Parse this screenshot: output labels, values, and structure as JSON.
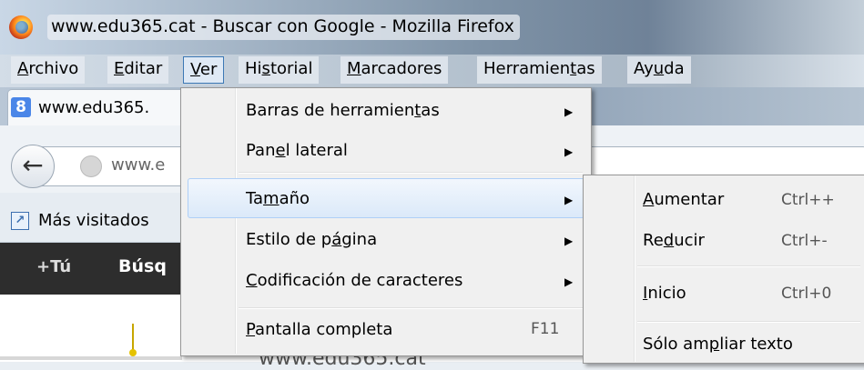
{
  "window": {
    "title": "www.edu365.cat - Buscar con Google - Mozilla Firefox"
  },
  "menubar": {
    "archivo": {
      "pre": "",
      "u": "A",
      "post": "rchivo"
    },
    "editar": {
      "pre": "",
      "u": "E",
      "post": "ditar"
    },
    "ver": {
      "pre": "",
      "u": "V",
      "post": "er"
    },
    "historial": {
      "pre": "Hi",
      "u": "s",
      "post": "torial"
    },
    "marcadores": {
      "pre": "",
      "u": "M",
      "post": "arcadores"
    },
    "herramientas": {
      "pre": "Herramien",
      "u": "t",
      "post": "as"
    },
    "ayuda": {
      "pre": "Ay",
      "u": "u",
      "post": "da"
    }
  },
  "tab": {
    "label": "www.edu365.",
    "icon": "google-icon"
  },
  "navbar": {
    "url_partial": "www.e"
  },
  "bookmarks": {
    "label": "Más visitados"
  },
  "google_bar": {
    "plus_you": "+Tú",
    "search_partial": "Búsq"
  },
  "page": {
    "text_partial": "www.edu365.cat"
  },
  "ver_menu": {
    "toolbars": {
      "pre": "Barras de herramien",
      "u": "t",
      "post": "as"
    },
    "sidebar": {
      "pre": "Pan",
      "u": "e",
      "post": "l lateral"
    },
    "size": {
      "pre": "Ta",
      "u": "m",
      "post": "año"
    },
    "page_style": {
      "pre": "Estilo de p",
      "u": "á",
      "post": "gina"
    },
    "encoding": {
      "pre": "",
      "u": "C",
      "post": "odificación de caracteres"
    },
    "fullscreen": {
      "pre": "",
      "u": "P",
      "post": "antalla completa"
    },
    "fullscreen_shortcut": "F11"
  },
  "size_menu": {
    "zoom_in": {
      "pre": "",
      "u": "A",
      "post": "umentar"
    },
    "zoom_in_shortcut": "Ctrl++",
    "zoom_out": {
      "pre": "Re",
      "u": "d",
      "post": "ucir"
    },
    "zoom_out_shortcut": "Ctrl+-",
    "reset": {
      "pre": "",
      "u": "I",
      "post": "nicio"
    },
    "reset_shortcut": "Ctrl+0",
    "text_only": {
      "pre": "Sólo am",
      "u": "p",
      "post": "liar texto"
    }
  },
  "colors": {
    "accent": "#3c78b5",
    "selection": "#dbe9f9",
    "google_bar": "#2d2d2d"
  }
}
